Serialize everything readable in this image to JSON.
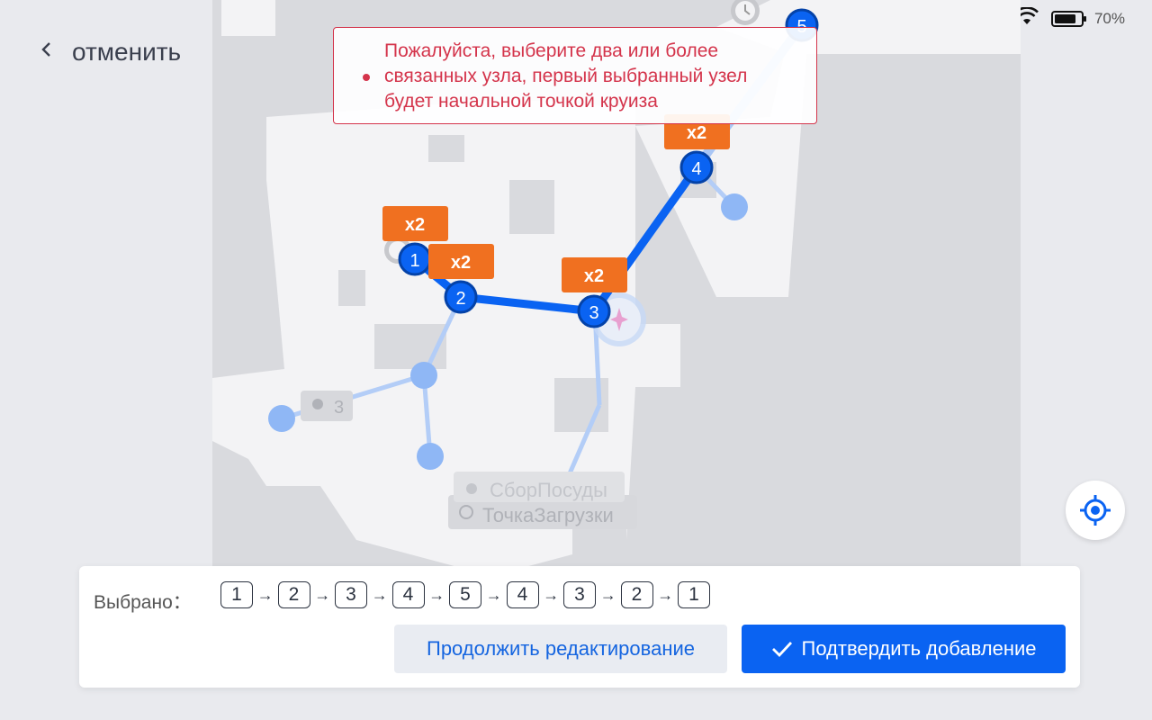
{
  "status_bar": {
    "battery_text": "70%",
    "wifi_icon": "wifi-icon",
    "battery_icon": "battery-icon"
  },
  "header": {
    "back_label": "отменить"
  },
  "alert": {
    "text": "Пожалуйста, выберите два или более связанных узла, первый выбранный узел будет начальной точкой круиза"
  },
  "map": {
    "nodes_selected": [
      {
        "label": "1",
        "speed_tag": "x2"
      },
      {
        "label": "2",
        "speed_tag": "x2"
      },
      {
        "label": "3",
        "speed_tag": "x2"
      },
      {
        "label": "4",
        "speed_tag": "x2"
      },
      {
        "label": "5"
      }
    ],
    "poi_labels": {
      "dish_collection": "СборПосуды",
      "charging_point": "ТочкаЗагрузки",
      "marker_s": "3"
    }
  },
  "panel": {
    "selected_label": "Выбрано：",
    "sequence": [
      "1",
      "2",
      "3",
      "4",
      "5",
      "4",
      "3",
      "2",
      "1"
    ],
    "continue_label": "Продолжить редактирование",
    "confirm_label": "Подтвердить добавление"
  },
  "colors": {
    "primary": "#0a63f2",
    "accent_orange": "#f07020",
    "alert_red": "#d4344b"
  }
}
